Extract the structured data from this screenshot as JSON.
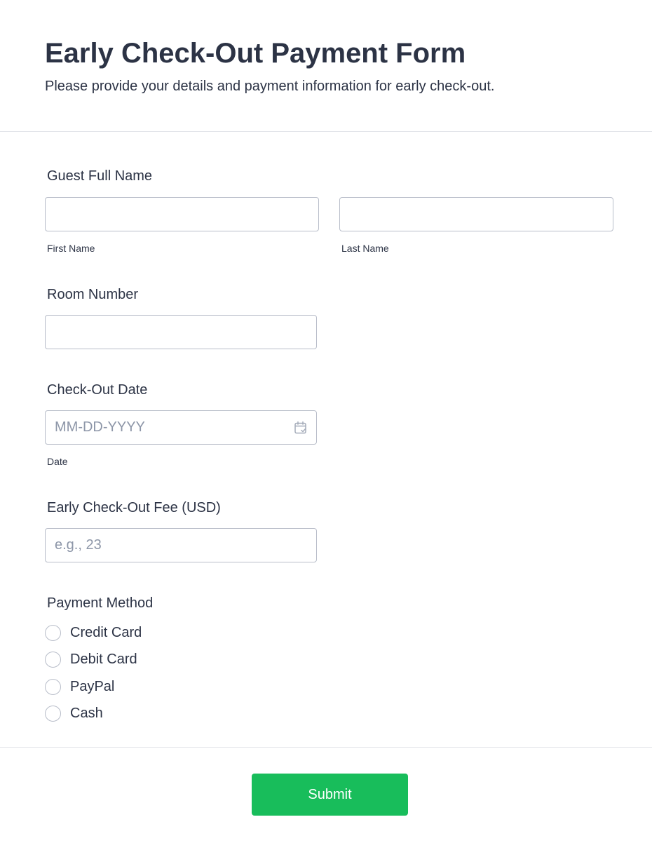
{
  "form": {
    "title": "Early Check-Out Payment Form",
    "subtitle": "Please provide your details and payment information for early check-out."
  },
  "guest_name": {
    "label": "Guest Full Name",
    "first_name": {
      "value": "",
      "sublabel": "First Name"
    },
    "last_name": {
      "value": "",
      "sublabel": "Last Name"
    }
  },
  "room_number": {
    "label": "Room Number",
    "value": ""
  },
  "checkout_date": {
    "label": "Check-Out Date",
    "placeholder": "MM-DD-YYYY",
    "sublabel": "Date",
    "icon": "calendar-icon"
  },
  "fee": {
    "label": "Early Check-Out Fee (USD)",
    "placeholder": "e.g., 23"
  },
  "payment_method": {
    "label": "Payment Method",
    "options": [
      {
        "label": "Credit Card",
        "selected": false
      },
      {
        "label": "Debit Card",
        "selected": false
      },
      {
        "label": "PayPal",
        "selected": false
      },
      {
        "label": "Cash",
        "selected": false
      }
    ]
  },
  "submit": {
    "label": "Submit",
    "color": "#18bd5b"
  }
}
